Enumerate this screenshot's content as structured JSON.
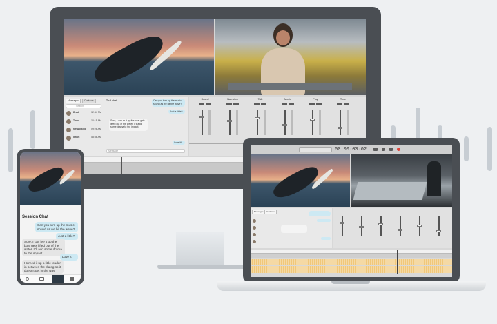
{
  "monitor": {
    "chat": {
      "tabs": [
        "Messages",
        "Contacts"
      ],
      "to_label": "To: Label",
      "search_placeholder": "Search",
      "contacts": [
        {
          "name": "Brad",
          "time": "12:34 PM"
        },
        {
          "name": "Tiana",
          "time": "10:15 AM"
        },
        {
          "name": "Networking",
          "time": "09:28 AM"
        },
        {
          "name": "Ikram",
          "time": "08:56 AM"
        }
      ],
      "messages": [
        {
          "dir": "out",
          "text": "Can you turn up the music sound as we hit the wave?"
        },
        {
          "dir": "out",
          "text": "Just a little?"
        },
        {
          "dir": "in",
          "text": "Sure, I can re it up the boat gets lifted out of the water. It'll add some drama to the impact."
        },
        {
          "dir": "out",
          "text": "Love it!"
        }
      ],
      "input_placeholder": "Message"
    },
    "mixer": {
      "channels": [
        "Sound",
        "Narration",
        "Talk",
        "Music",
        "Play",
        "Tone"
      ]
    }
  },
  "phone": {
    "title": "Session Chat",
    "messages": [
      {
        "dir": "out",
        "text": "Can you turn up the music sound as we hit the wave?"
      },
      {
        "dir": "out",
        "text": "Just a little?"
      },
      {
        "dir": "in",
        "text": "Sure, I can lee it up the boat gets lifted out of the water. It'll add some drama to the impact."
      },
      {
        "dir": "out",
        "text": "Love it!"
      },
      {
        "dir": "in",
        "text": "I turned it up a little louder in between the dialog so it doesn't get in the way."
      }
    ],
    "nav": [
      "",
      "",
      "",
      ""
    ]
  },
  "laptop": {
    "timecode": "00:00:03:02",
    "colors": {
      "record": "#e0433a",
      "waveform": "#f0c77a"
    }
  }
}
